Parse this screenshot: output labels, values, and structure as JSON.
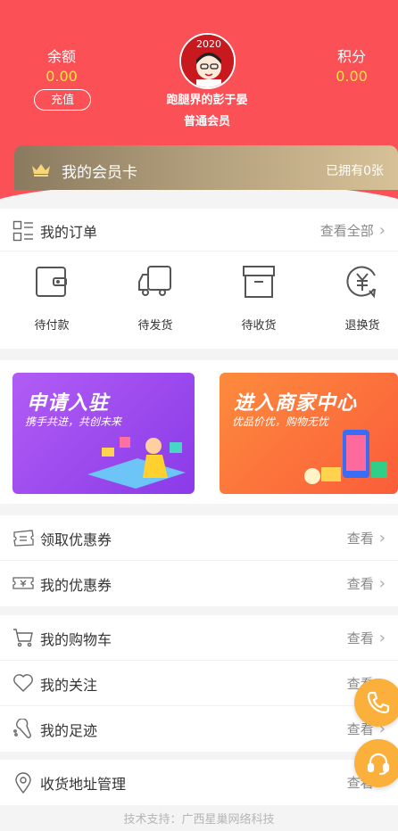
{
  "header": {
    "balance_label": "余额",
    "balance_value": "0.00",
    "recharge_label": "充值",
    "points_label": "积分",
    "points_value": "0.00",
    "username": "跑腿界的彭于晏",
    "member_level": "普通会员",
    "avatar_text": "2020"
  },
  "vip_card": {
    "title": "我的会员卡",
    "owned": "已拥有0张"
  },
  "orders": {
    "title": "我的订单",
    "view_all": "查看全部",
    "statuses": [
      {
        "label": "待付款",
        "icon": "wallet-icon"
      },
      {
        "label": "待发货",
        "icon": "truck-icon"
      },
      {
        "label": "待收货",
        "icon": "box-icon"
      },
      {
        "label": "退换货",
        "icon": "yuan-refund-icon"
      }
    ]
  },
  "banners": {
    "join": {
      "title": "申请入驻",
      "subtitle": "携手共进，共创未来"
    },
    "merchant": {
      "title": "进入商家中心",
      "subtitle": "优品价优，购物无忧"
    }
  },
  "menu": {
    "get_coupon": {
      "label": "领取优惠券",
      "action": "查看"
    },
    "my_coupon": {
      "label": "我的优惠券",
      "action": "查看"
    },
    "cart": {
      "label": "我的购物车",
      "action": "查看"
    },
    "follow": {
      "label": "我的关注",
      "action": "查看"
    },
    "footprint": {
      "label": "我的足迹",
      "action": "查看"
    },
    "address": {
      "label": "收货地址管理",
      "action": "查看"
    }
  },
  "footer": {
    "text": "技术支持：广西星巢网络科技"
  },
  "colors": {
    "header_red": "#fb5056",
    "balance_yellow": "#ffe24a",
    "fab_orange": "#fbb03b"
  }
}
